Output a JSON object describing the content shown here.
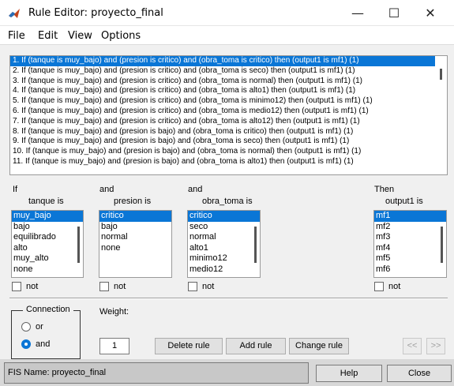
{
  "window": {
    "title": "Rule Editor: proyecto_final",
    "minimize": "—",
    "maximize": "☐",
    "close": "✕"
  },
  "menu": [
    "File",
    "Edit",
    "View",
    "Options"
  ],
  "rules": [
    "1. If (tanque is muy_bajo) and (presion is critico) and (obra_toma is critico) then (output1 is mf1) (1)",
    "2. If (tanque is muy_bajo) and (presion is critico) and (obra_toma is seco) then (output1 is mf1) (1)",
    "3. If (tanque is muy_bajo) and (presion is critico) and (obra_toma is normal) then (output1 is mf1) (1)",
    "4. If (tanque is muy_bajo) and (presion is critico) and (obra_toma is alto1) then (output1 is mf1) (1)",
    "5. If (tanque is muy_bajo) and (presion is critico) and (obra_toma is minimo12) then (output1 is mf1) (1)",
    "6. If (tanque is muy_bajo) and (presion is critico) and (obra_toma is medio12) then (output1 is mf1) (1)",
    "7. If (tanque is muy_bajo) and (presion is critico) and (obra_toma is alto12) then (output1 is mf1) (1)",
    "8. If (tanque is muy_bajo) and (presion is bajo) and (obra_toma is critico) then (output1 is mf1) (1)",
    "9. If (tanque is muy_bajo) and (presion is bajo) and (obra_toma is seco) then (output1 is mf1) (1)",
    "10. If (tanque is muy_bajo) and (presion is bajo) and (obra_toma is normal) then (output1 is mf1) (1)",
    "11. If (tanque is muy_bajo) and (presion is bajo) and (obra_toma is alto1) then (output1 is mf1) (1)"
  ],
  "selected_rule": 0,
  "columns": {
    "tanque": {
      "prefix": "If",
      "label": "tanque is",
      "items": [
        "muy_bajo",
        "bajo",
        "equilibrado",
        "alto",
        "muy_alto",
        "none"
      ],
      "selected": 0,
      "not_label": "not"
    },
    "presion": {
      "prefix": "and",
      "label": "presion is",
      "items": [
        "critico",
        "bajo",
        "normal",
        "none"
      ],
      "selected": 0,
      "not_label": "not"
    },
    "obra_toma": {
      "prefix": "and",
      "label": "obra_toma is",
      "items": [
        "critico",
        "seco",
        "normal",
        "alto1",
        "minimo12",
        "medio12"
      ],
      "selected": 0,
      "not_label": "not"
    },
    "output1": {
      "prefix": "Then",
      "label": "output1 is",
      "items": [
        "mf1",
        "mf2",
        "mf3",
        "mf4",
        "mf5",
        "mf6"
      ],
      "selected": 0,
      "not_label": "not"
    }
  },
  "connection": {
    "title": "Connection",
    "options": [
      "or",
      "and"
    ],
    "selected": "and"
  },
  "weight": {
    "label": "Weight:",
    "value": "1"
  },
  "buttons": {
    "delete": "Delete rule",
    "add": "Add rule",
    "change": "Change rule",
    "prev": "<<",
    "next": ">>"
  },
  "status": {
    "fis_name": "FIS Name: proyecto_final",
    "help": "Help",
    "close": "Close"
  },
  "colors": {
    "selection": "#0a76d6",
    "background": "#f0f0f0",
    "matlab_icon": "#c4441c"
  }
}
